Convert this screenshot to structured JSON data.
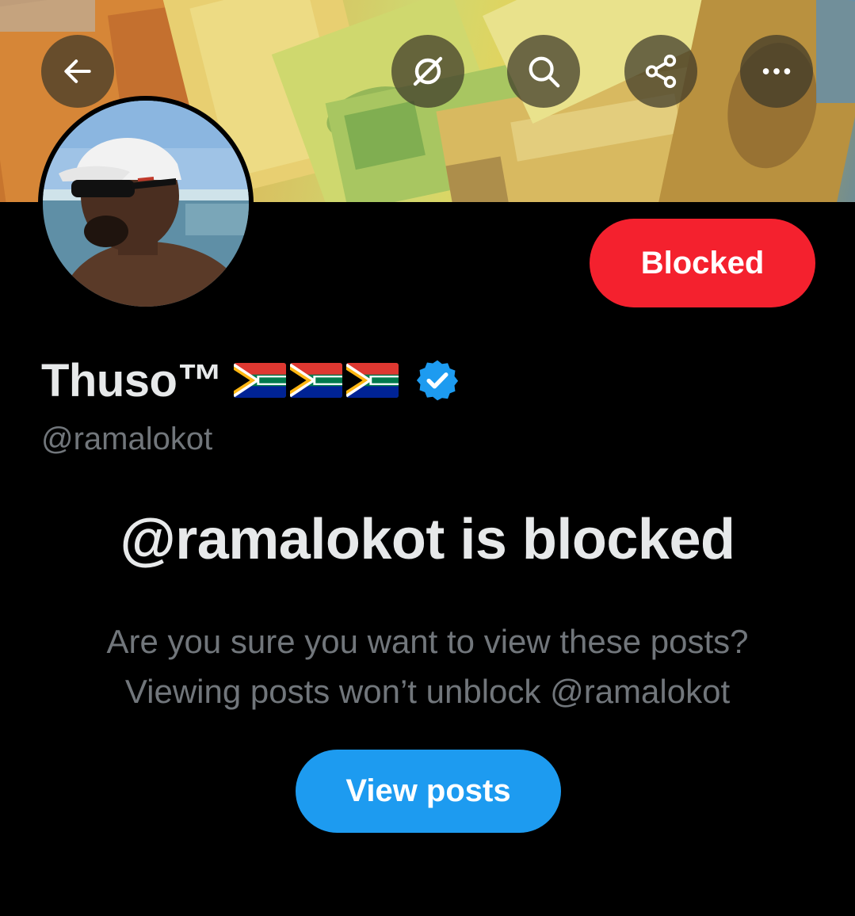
{
  "banner": {
    "description_icon": "currency-banner-image"
  },
  "top_actions": {
    "back_icon": "arrow-left-icon",
    "grok_icon": "grok-icon",
    "search_icon": "search-icon",
    "share_icon": "share-icon",
    "more_icon": "more-icon"
  },
  "profile": {
    "display_name": "Thuso™",
    "flags": [
      "south-africa-flag-icon",
      "south-africa-flag-icon",
      "south-africa-flag-icon"
    ],
    "verified_icon": "verified-badge-icon",
    "handle": "@ramalokot",
    "blocked_label": "Blocked"
  },
  "blocked_notice": {
    "headline": "@ramalokot is blocked",
    "line1": "Are you sure you want to view these posts?",
    "line2": "Viewing posts won’t unblock @ramalokot",
    "view_button": "View posts"
  },
  "colors": {
    "background": "#000000",
    "blocked_red": "#f4212e",
    "primary_blue": "#1d9bf0",
    "text_primary": "#e7e9ea",
    "text_secondary": "#71767b"
  }
}
